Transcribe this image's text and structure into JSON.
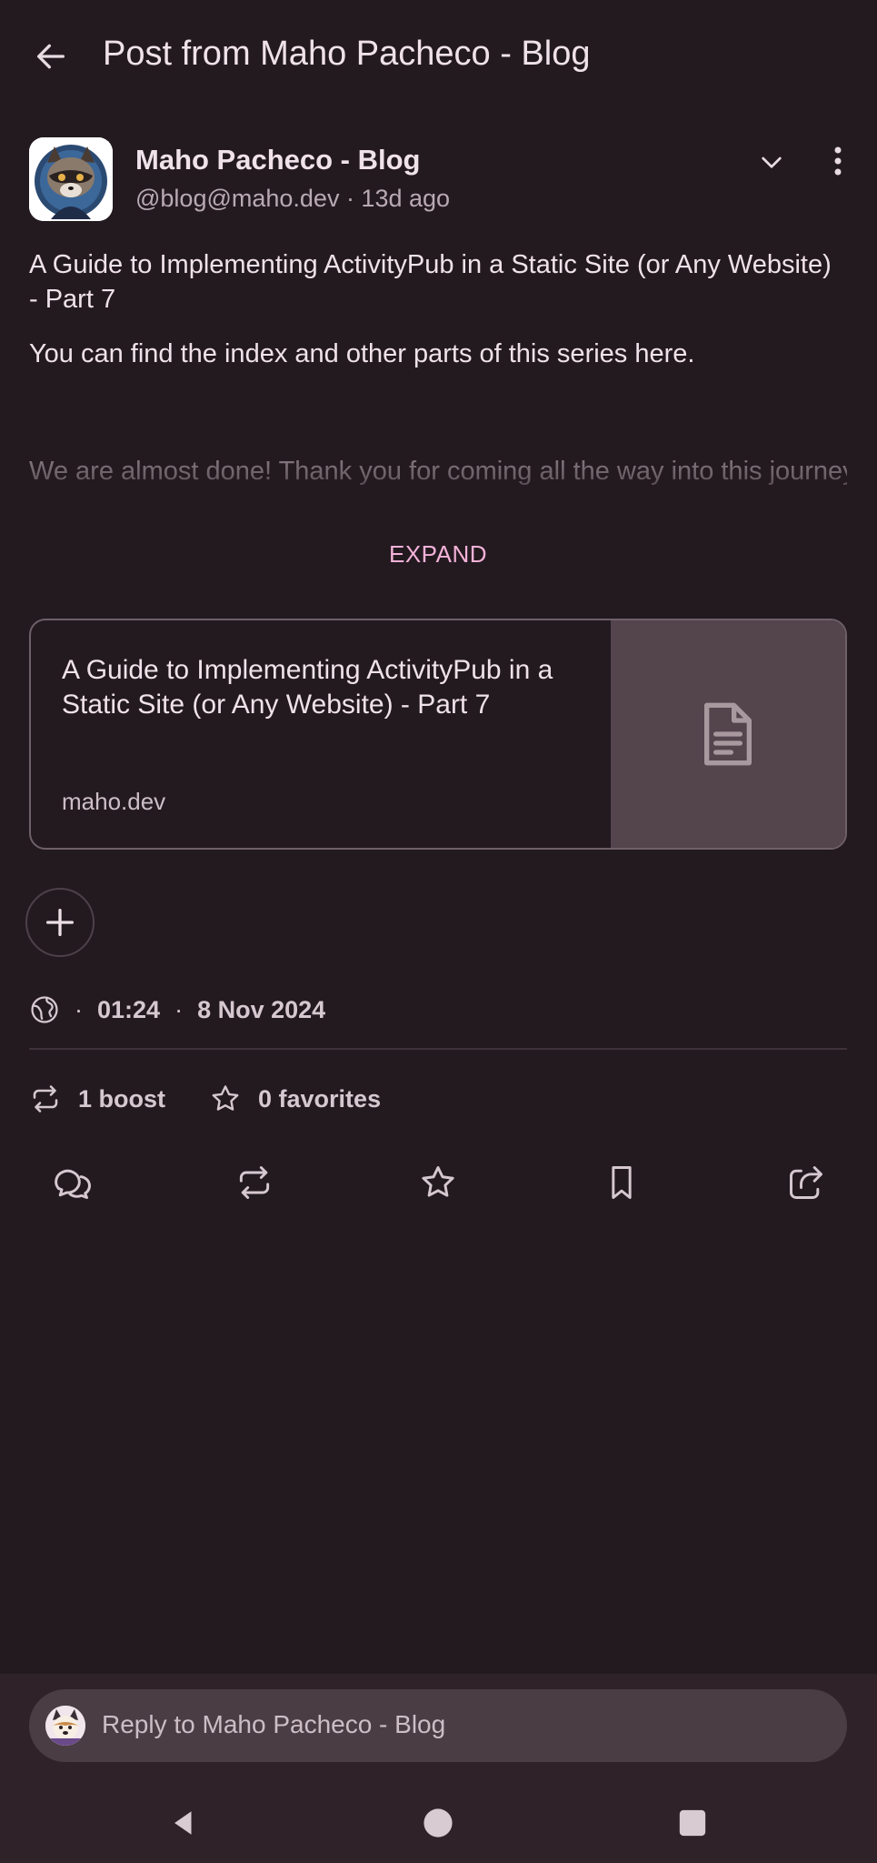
{
  "header": {
    "title": "Post from Maho Pacheco - Blog",
    "back_icon": "arrow-left-icon"
  },
  "post": {
    "author_name": "Maho Pacheco - Blog",
    "handle": "@blog@maho.dev",
    "time_ago": "13d ago",
    "meta_line": "@blog@maho.dev · 13d ago",
    "title": "A Guide to Implementing ActivityPub in a Static Site (or Any Website) - Part 7",
    "intro": "You can find the index and other parts of this series here.",
    "faded_text": " We are almost done! Thank you for coming all the way into this journey. In this part we will learn how to broadcast (aka",
    "expand_label": "EXPAND"
  },
  "link_card": {
    "title": "A Guide to Implementing ActivityPub in a Static Site (or Any Website) - Part 7",
    "domain": "maho.dev",
    "thumb_icon": "document-icon"
  },
  "meta": {
    "visibility_icon": "globe-icon",
    "time": "01:24",
    "date": "8 Nov 2024",
    "separator": "·"
  },
  "stats": {
    "boosts": "1 boost",
    "favorites": "0 favorites"
  },
  "actions": [
    "reply-icon",
    "boost-icon",
    "favorite-icon",
    "bookmark-icon",
    "share-icon"
  ],
  "reply": {
    "placeholder": "Reply to Maho Pacheco - Blog"
  },
  "colors": {
    "background": "#231a20",
    "accent": "#f4b2d8",
    "text": "#efe2e8",
    "reply_bar": "#2f2329"
  }
}
